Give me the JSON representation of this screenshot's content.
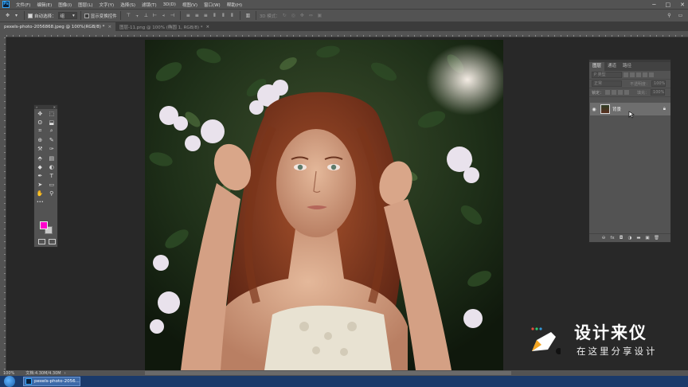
{
  "app": {
    "logo_text": "Ps",
    "menu": [
      "文件(F)",
      "编辑(E)",
      "图像(I)",
      "图层(L)",
      "文字(Y)",
      "选择(S)",
      "滤镜(T)",
      "3D(D)",
      "视图(V)",
      "窗口(W)",
      "帮助(H)"
    ],
    "window_controls": [
      "─",
      "□",
      "✕"
    ]
  },
  "options_bar": {
    "auto_select_label": "自动选择：",
    "auto_select_value": "组",
    "auto_select_checked": true,
    "transform_label": "显示变换控件",
    "transform_checked": false,
    "mode_3d_label": "3D 模式："
  },
  "tabs": [
    {
      "label": "pexels-photo-2056868.jpeg @ 100%(RGB/8) *",
      "active": true
    },
    {
      "label": "图层-11.png @ 100% (椭圆 1, RGB/8) *",
      "active": false
    }
  ],
  "tools": {
    "header_left": "»",
    "header_right": "✕",
    "rows": [
      [
        "✥",
        "⬚"
      ],
      [
        "ʘ",
        "⬓"
      ],
      [
        "⌗",
        "⌕"
      ],
      [
        "⊕",
        "✎"
      ],
      [
        "⚒",
        "✑"
      ],
      [
        "⬘",
        "▤"
      ],
      [
        "◆",
        "◐"
      ],
      [
        "✒",
        "T"
      ],
      [
        "➤",
        "▭"
      ],
      [
        "✋",
        "⚲"
      ],
      [
        "•••",
        ""
      ]
    ]
  },
  "colors": {
    "foreground": "#ff00cc",
    "background": "#c8c8c8",
    "accent_ps": "#31a8ff"
  },
  "layers_panel": {
    "tabs": [
      "图层",
      "通道",
      "路径"
    ],
    "filter_label": "P 类型",
    "blend_mode": "正常",
    "opacity_label": "不透明度：",
    "opacity_value": "100%",
    "lock_label": "锁定：",
    "fill_label": "填充：",
    "fill_value": "100%",
    "layer_name": "背景",
    "footer_icons": [
      "link-icon",
      "fx-icon",
      "mask-icon",
      "adjustment-icon",
      "group-icon",
      "new-layer-icon",
      "trash-icon"
    ],
    "footer_glyphs": [
      "⊖",
      "fx",
      "◘",
      "◑",
      "▬",
      "▣",
      "🗑"
    ]
  },
  "status_bar": {
    "zoom": "100%",
    "doc_info": "文档:4.30M/4.30M"
  },
  "taskbar": {
    "app_label": "pexels-photo-2056..."
  },
  "watermark": {
    "title": "设计来仪",
    "subtitle": "在这里分享设计"
  }
}
